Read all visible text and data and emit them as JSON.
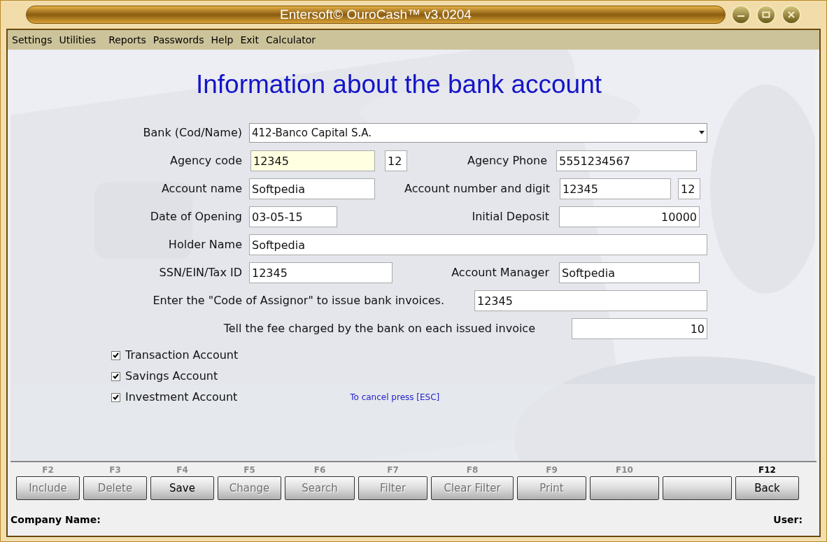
{
  "window": {
    "title": "Entersoft© OuroCash™ v3.0204"
  },
  "menu": [
    {
      "label": "Settings"
    },
    {
      "label": "Utilities"
    },
    {
      "label": "Reports"
    },
    {
      "label": "Passwords"
    },
    {
      "label": "Help"
    },
    {
      "label": "Exit"
    },
    {
      "label": "Calculator"
    }
  ],
  "heading": "Information about the bank account",
  "form_rows": [
    {
      "items": [
        {
          "kind": "label",
          "text": "Bank (Cod/Name)"
        },
        {
          "kind": "select",
          "value": "412-Banco Capital S.A."
        }
      ]
    },
    {
      "items": [
        {
          "kind": "label",
          "text": "Agency code"
        },
        {
          "kind": "input",
          "value": "12345",
          "focused": true
        },
        {
          "kind": "input",
          "value": "12"
        },
        {
          "kind": "label",
          "text": "Agency Phone"
        },
        {
          "kind": "input",
          "value": "5551234567"
        }
      ]
    },
    {
      "items": [
        {
          "kind": "label",
          "text": "Account name"
        },
        {
          "kind": "input",
          "value": "Softpedia"
        },
        {
          "kind": "label",
          "text": "Account number and digit"
        },
        {
          "kind": "input",
          "value": "12345"
        },
        {
          "kind": "input",
          "value": "12"
        }
      ]
    },
    {
      "items": [
        {
          "kind": "label",
          "text": "Date of Opening"
        },
        {
          "kind": "input",
          "value": "03-05-15"
        },
        {
          "kind": "label",
          "text": "Initial Deposit"
        },
        {
          "kind": "input",
          "value": "10000",
          "numeric": true
        }
      ]
    },
    {
      "items": [
        {
          "kind": "label",
          "text": "Holder Name"
        },
        {
          "kind": "input",
          "value": "Softpedia"
        }
      ]
    },
    {
      "items": [
        {
          "kind": "label",
          "text": "SSN/EIN/Tax ID"
        },
        {
          "kind": "input",
          "value": "12345"
        },
        {
          "kind": "label",
          "text": "Account Manager"
        },
        {
          "kind": "input",
          "value": "Softpedia"
        }
      ]
    },
    {
      "items": [
        {
          "kind": "label",
          "text": "Enter the \"Code of Assignor\" to issue bank invoices."
        },
        {
          "kind": "input",
          "value": "12345"
        }
      ]
    },
    {
      "items": [
        {
          "kind": "label",
          "text": "Tell the fee charged by the bank on each issued invoice"
        },
        {
          "kind": "input",
          "value": "10",
          "numeric": true
        }
      ]
    }
  ],
  "checkboxes": [
    {
      "label": "Transaction Account",
      "checked": true
    },
    {
      "label": "Savings Account",
      "checked": true
    },
    {
      "label": "Investment Account",
      "checked": true
    }
  ],
  "cancel_hint": "To cancel press [ESC]",
  "buttons": [
    {
      "kind": "command",
      "key": "F2",
      "label": "Include",
      "disabled": true,
      "emphasized": false
    },
    {
      "kind": "command",
      "key": "F3",
      "label": "Delete",
      "disabled": true,
      "emphasized": false
    },
    {
      "kind": "command",
      "key": "F4",
      "label": "Save",
      "disabled": false,
      "emphasized": false
    },
    {
      "kind": "command",
      "key": "F5",
      "label": "Change",
      "disabled": true,
      "emphasized": false
    },
    {
      "kind": "command",
      "key": "F6",
      "label": "Search",
      "disabled": true,
      "emphasized": false
    },
    {
      "kind": "command",
      "key": "F7",
      "label": "Filter",
      "disabled": true,
      "emphasized": false
    },
    {
      "kind": "command",
      "key": "F8",
      "label": "Clear Filter",
      "disabled": true,
      "emphasized": false
    },
    {
      "kind": "command",
      "key": "F9",
      "label": "Print",
      "disabled": true,
      "emphasized": false
    },
    {
      "kind": "blank",
      "key": "F10",
      "emphasized": false
    },
    {
      "kind": "blank"
    },
    {
      "kind": "command",
      "key": "F12",
      "label": "Back",
      "disabled": false,
      "emphasized": true
    }
  ],
  "status_bar": {
    "company_label": "Company Name:",
    "user_label": "User:"
  }
}
